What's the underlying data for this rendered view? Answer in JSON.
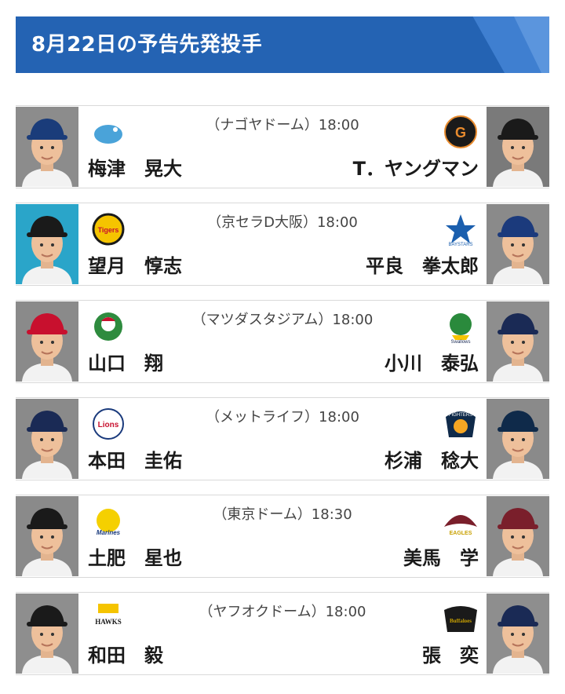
{
  "header": {
    "title": "8月22日の予告先発投手"
  },
  "games": [
    {
      "venue": "（ナゴヤドーム）18:00",
      "home": {
        "pitcher": "梅津　晃大",
        "logo": "dragons-logo",
        "cap": "#1a3c7a",
        "bg": "#8c8c8c",
        "logo_text": ""
      },
      "away": {
        "pitcher": "T．ヤングマン",
        "logo": "giants-logo",
        "cap": "#1a1a1a",
        "bg": "#7a7a7a",
        "logo_text": "G"
      }
    },
    {
      "venue": "（京セラD大阪）18:00",
      "home": {
        "pitcher": "望月　惇志",
        "logo": "tigers-logo",
        "cap": "#1a1a1a",
        "bg": "#2aa5c9",
        "logo_text": "Tigers"
      },
      "away": {
        "pitcher": "平良　拳太郎",
        "logo": "baystars-logo",
        "cap": "#1b3a7c",
        "bg": "#8a8a8a",
        "logo_text": "BAYSTARS"
      }
    },
    {
      "venue": "（マツダスタジアム）18:00",
      "home": {
        "pitcher": "山口　翔",
        "logo": "carp-logo",
        "cap": "#c8102e",
        "bg": "#8a8a8a",
        "logo_text": ""
      },
      "away": {
        "pitcher": "小川　泰弘",
        "logo": "swallows-logo",
        "cap": "#1a2a55",
        "bg": "#8e8e8e",
        "logo_text": "Swallows"
      }
    },
    {
      "venue": "（メットライフ）18:00",
      "home": {
        "pitcher": "本田　圭佑",
        "logo": "lions-logo",
        "cap": "#1a2a55",
        "bg": "#8a8a8a",
        "logo_text": "Lions"
      },
      "away": {
        "pitcher": "杉浦　稔大",
        "logo": "fighters-logo",
        "cap": "#0f2a4a",
        "bg": "#8a8a8a",
        "logo_text": "FIGHTERS"
      }
    },
    {
      "venue": "（東京ドーム）18:30",
      "home": {
        "pitcher": "土肥　星也",
        "logo": "marines-logo",
        "cap": "#1a1a1a",
        "bg": "#8a8a8a",
        "logo_text": "Marines"
      },
      "away": {
        "pitcher": "美馬　学",
        "logo": "eagles-logo",
        "cap": "#7a1f2b",
        "bg": "#8a8a8a",
        "logo_text": "EAGLES"
      }
    },
    {
      "venue": "（ヤフオクドーム）18:00",
      "home": {
        "pitcher": "和田　毅",
        "logo": "hawks-logo",
        "cap": "#1a1a1a",
        "bg": "#8e8e8e",
        "logo_text": "HAWKS"
      },
      "away": {
        "pitcher": "張　奕",
        "logo": "buffaloes-logo",
        "cap": "#1a2a55",
        "bg": "#8e8e8e",
        "logo_text": "Buffaloes"
      }
    }
  ]
}
